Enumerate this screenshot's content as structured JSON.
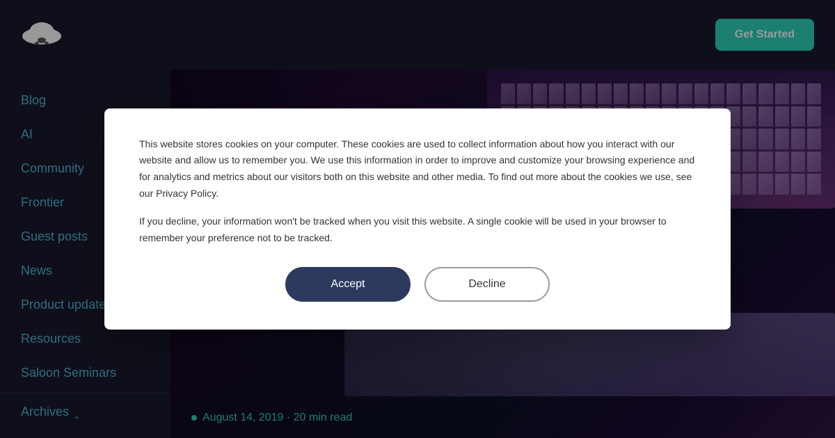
{
  "header": {
    "get_started_label": "Get Started"
  },
  "sidebar": {
    "items": [
      {
        "label": "Blog",
        "id": "blog"
      },
      {
        "label": "AI",
        "id": "ai"
      },
      {
        "label": "Community",
        "id": "community"
      },
      {
        "label": "Frontier",
        "id": "frontier"
      },
      {
        "label": "Guest posts",
        "id": "guest-posts"
      },
      {
        "label": "News",
        "id": "news"
      },
      {
        "label": "Product updates",
        "id": "product-updates"
      },
      {
        "label": "Resources",
        "id": "resources"
      },
      {
        "label": "Saloon Seminars",
        "id": "saloon-seminars"
      },
      {
        "label": "Archives",
        "id": "archives"
      }
    ]
  },
  "main": {
    "post_date": "August 14, 2019",
    "post_read_time": "20 min read",
    "post_meta": "August 14, 2019 · 20 min read"
  },
  "cookie_banner": {
    "text1": "This website stores cookies on your computer. These cookies are used to collect information about how you interact with our website and allow us to remember you. We use this information in order to improve and customize your browsing experience and for analytics and metrics about our visitors both on this website and other media. To find out more about the cookies we use, see our Privacy Policy.",
    "text2": "If you decline, your information won't be tracked when you visit this website. A single cookie will be used in your browser to remember your preference not to be tracked.",
    "accept_label": "Accept",
    "decline_label": "Decline"
  },
  "icons": {
    "chevron": "^",
    "logo_alt": "Cowboy hat logo"
  }
}
